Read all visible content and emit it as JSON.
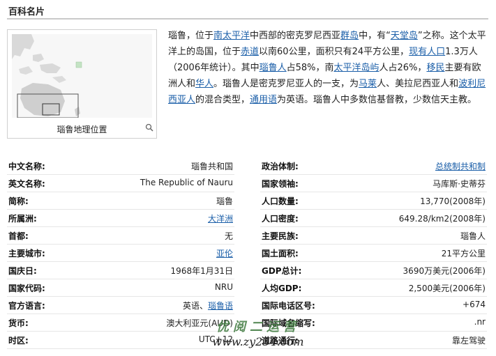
{
  "header": {
    "title": "百科名片"
  },
  "map": {
    "caption": "瑙鲁地理位置"
  },
  "intro": {
    "t1": "瑙鲁，位于",
    "l1": "南太平洋",
    "t2": "中西部的密克罗尼西亚",
    "l2": "群岛",
    "t3": "中，有“",
    "l3": "天堂岛",
    "t4": "”之称。这个太平洋上的岛国，位于",
    "l4": "赤道",
    "t5": "以南60公里，面积只有24平方公里，",
    "l5": "现有人口",
    "t6": "1.3万人（2006年统计）。其中",
    "l6": "瑙鲁人",
    "t7": "占58%，南",
    "l7": "太平洋岛屿",
    "t8": "人占26%，",
    "l8": "移民",
    "t9": "主要有欧洲人和",
    "l9": "华人",
    "t10": "。瑙鲁人是密克罗尼亚人的一支，为",
    "l10": "马莱",
    "t11": "人、美拉尼西亚人和",
    "l11": "波利尼西亚人",
    "t12": "的混合类型，",
    "l12": "通用语",
    "t13": "为英语。瑙鲁人中多数信基督教，少数信天主教。"
  },
  "left_rows": [
    {
      "label": "中文名称:",
      "value": "瑙鲁共和国"
    },
    {
      "label": "英文名称:",
      "value": "The Republic of Nauru"
    },
    {
      "label": "简称:",
      "value": "瑙鲁"
    },
    {
      "label": "所属洲:",
      "value": "大洋洲"
    },
    {
      "label": "首都:",
      "value": "无"
    },
    {
      "label": "主要城市:",
      "value": "亚伦"
    },
    {
      "label": "国庆日:",
      "value": "1968年1月31日"
    },
    {
      "label": "国家代码:",
      "value": "NRU"
    },
    {
      "label": "官方语言:",
      "value": "英语、",
      "value2": "瑙鲁语"
    },
    {
      "label": "货币:",
      "value": "澳大利亚元(AUD)"
    },
    {
      "label": "时区:",
      "value": "UTC+12"
    }
  ],
  "right_rows": [
    {
      "label": "政治体制:",
      "value": "总统制共和制"
    },
    {
      "label": "国家领袖:",
      "value": "马库斯·史蒂芬"
    },
    {
      "label": "人口数量:",
      "value": "13,770(2008年)"
    },
    {
      "label": "人口密度:",
      "value": "649.28/km2(2008年)"
    },
    {
      "label": "主要民族:",
      "value": "瑙鲁人"
    },
    {
      "label": "国土面积:",
      "value": "21平方公里"
    },
    {
      "label": "GDP总计:",
      "value": "3690万美元(2006年)"
    },
    {
      "label": "人均GDP:",
      "value": "2,500美元(2006年)"
    },
    {
      "label": "国际电话区号:",
      "value": "+674"
    },
    {
      "label": "国际域名缩写:",
      "value": ".nr"
    },
    {
      "label": "道路通行:",
      "value": "靠左驾驶"
    }
  ],
  "watermark": {
    "cn": "优阅二运营",
    "url": "www.zy234.com"
  }
}
